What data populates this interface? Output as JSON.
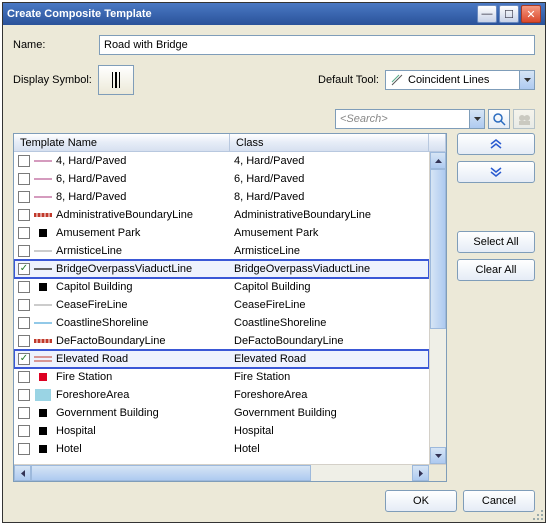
{
  "window": {
    "title": "Create Composite Template"
  },
  "fields": {
    "name_label": "Name:",
    "name_value": "Road with Bridge",
    "display_symbol_label": "Display Symbol:",
    "default_tool_label": "Default Tool:",
    "default_tool_value": "Coincident Lines",
    "search_placeholder": "<Search>"
  },
  "table": {
    "col1": "Template Name",
    "col2": "Class",
    "rows": [
      {
        "checked": false,
        "label": "4, Hard/Paved",
        "class": "4, Hard/Paved",
        "sym": {
          "type": "line",
          "color": "#c77aa8"
        }
      },
      {
        "checked": false,
        "label": "6, Hard/Paved",
        "class": "6, Hard/Paved",
        "sym": {
          "type": "line",
          "color": "#c77aa8"
        }
      },
      {
        "checked": false,
        "label": "8, Hard/Paved",
        "class": "8, Hard/Paved",
        "sym": {
          "type": "line",
          "color": "#c77aa8"
        }
      },
      {
        "checked": false,
        "label": "AdministrativeBoundaryLine",
        "class": "AdministrativeBoundaryLine",
        "sym": {
          "type": "dashband",
          "color": "#c1392b"
        }
      },
      {
        "checked": false,
        "label": "Amusement Park",
        "class": "Amusement Park",
        "sym": {
          "type": "square",
          "color": "#000"
        }
      },
      {
        "checked": false,
        "label": "ArmisticeLine",
        "class": "ArmisticeLine",
        "sym": {
          "type": "line",
          "color": "#bbb"
        }
      },
      {
        "checked": true,
        "label": "BridgeOverpassViaductLine",
        "class": "BridgeOverpassViaductLine",
        "sym": {
          "type": "line",
          "color": "#333"
        },
        "highlight": true
      },
      {
        "checked": false,
        "label": "Capitol Building",
        "class": "Capitol Building",
        "sym": {
          "type": "square",
          "color": "#000"
        }
      },
      {
        "checked": false,
        "label": "CeaseFireLine",
        "class": "CeaseFireLine",
        "sym": {
          "type": "line",
          "color": "#bbb"
        }
      },
      {
        "checked": false,
        "label": "CoastlineShoreline",
        "class": "CoastlineShoreline",
        "sym": {
          "type": "line",
          "color": "#6fb7e0"
        }
      },
      {
        "checked": false,
        "label": "DeFactoBoundaryLine",
        "class": "DeFactoBoundaryLine",
        "sym": {
          "type": "dashband",
          "color": "#c1392b"
        }
      },
      {
        "checked": true,
        "label": "Elevated Road",
        "class": "Elevated Road",
        "sym": {
          "type": "dbl-line",
          "color": "#c1392b"
        },
        "highlight": true
      },
      {
        "checked": false,
        "label": "Fire Station",
        "class": "Fire Station",
        "sym": {
          "type": "square",
          "color": "#d02"
        }
      },
      {
        "checked": false,
        "label": "ForeshoreArea",
        "class": "ForeshoreArea",
        "sym": {
          "type": "patch",
          "color": "#6fc2d9"
        }
      },
      {
        "checked": false,
        "label": "Government Building",
        "class": "Government Building",
        "sym": {
          "type": "square",
          "color": "#000"
        }
      },
      {
        "checked": false,
        "label": "Hospital",
        "class": "Hospital",
        "sym": {
          "type": "square",
          "color": "#000"
        }
      },
      {
        "checked": false,
        "label": "Hotel",
        "class": "Hotel",
        "sym": {
          "type": "square",
          "color": "#000"
        }
      }
    ]
  },
  "buttons": {
    "select_all": "Select All",
    "clear_all": "Clear All",
    "ok": "OK",
    "cancel": "Cancel"
  }
}
